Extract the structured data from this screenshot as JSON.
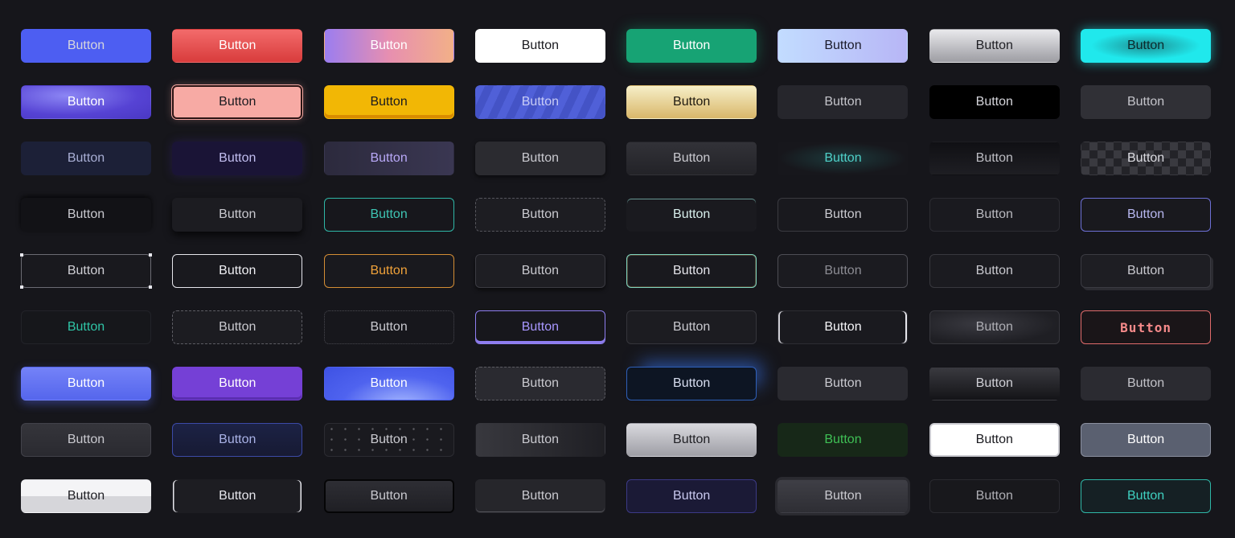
{
  "label": "Button",
  "colors": {
    "page_bg": "#16161b",
    "indigo": "#4b5cf0",
    "red": "#e54a4a",
    "green": "#19a577",
    "cyan": "#1fe6ea",
    "yellow": "#f2b705",
    "salmon": "#f7a9a3",
    "teal": "#2fb7a7",
    "orange": "#f0a23a",
    "violet": "#7540d6",
    "blue_glow": "#3a7bff",
    "pink_outline": "#f26b6b",
    "lime": "#2bbd43"
  },
  "rows": [
    [
      {
        "name": "solid-indigo-button"
      },
      {
        "name": "red-gradient-button"
      },
      {
        "name": "sunset-gradient-button"
      },
      {
        "name": "white-solid-button"
      },
      {
        "name": "green-solid-button"
      },
      {
        "name": "pastel-blue-gradient-button"
      },
      {
        "name": "silver-gradient-button"
      },
      {
        "name": "neon-cyan-button"
      }
    ],
    [
      {
        "name": "indigo-shine-button"
      },
      {
        "name": "salmon-outlined-button"
      },
      {
        "name": "yellow-3d-button"
      },
      {
        "name": "striped-blue-button"
      },
      {
        "name": "gold-gradient-button"
      },
      {
        "name": "dark-flat-button"
      },
      {
        "name": "black-solid-button"
      },
      {
        "name": "charcoal-flat-button"
      }
    ],
    [
      {
        "name": "navy-ghost-button"
      },
      {
        "name": "deep-purple-button"
      },
      {
        "name": "lavender-text-button"
      },
      {
        "name": "dark-raised-button"
      },
      {
        "name": "dark-gradient-button"
      },
      {
        "name": "teal-glow-text-button"
      },
      {
        "name": "black-fade-button"
      },
      {
        "name": "checkered-button"
      }
    ],
    [
      {
        "name": "black-shadow-button"
      },
      {
        "name": "dark-drop-shadow-button"
      },
      {
        "name": "teal-outline-button"
      },
      {
        "name": "dashed-outline-button"
      },
      {
        "name": "light-beam-button"
      },
      {
        "name": "thin-outline-button"
      },
      {
        "name": "subtle-outline-button"
      },
      {
        "name": "violet-outline-button"
      }
    ],
    [
      {
        "name": "selection-handles-button"
      },
      {
        "name": "white-outline-button"
      },
      {
        "name": "orange-outline-button"
      },
      {
        "name": "dark-border-button"
      },
      {
        "name": "gradient-border-button"
      },
      {
        "name": "sparkle-outline-button"
      },
      {
        "name": "crosshair-lines-button"
      },
      {
        "name": "stacked-outline-button"
      }
    ],
    [
      {
        "name": "teal-text-ghost-button"
      },
      {
        "name": "dashed-grey-button"
      },
      {
        "name": "dotted-border-button"
      },
      {
        "name": "purple-underline-button"
      },
      {
        "name": "dark-outline-button"
      },
      {
        "name": "white-edge-button"
      },
      {
        "name": "spotlight-button"
      },
      {
        "name": "pixel-pink-button"
      }
    ],
    [
      {
        "name": "periwinkle-solid-button"
      },
      {
        "name": "violet-solid-button"
      },
      {
        "name": "blue-glow-gradient-button"
      },
      {
        "name": "dashed-fill-button"
      },
      {
        "name": "blue-aura-button"
      },
      {
        "name": "grey-flat-button"
      },
      {
        "name": "black-gloss-button"
      },
      {
        "name": "slate-flat-button"
      }
    ],
    [
      {
        "name": "graphite-button"
      },
      {
        "name": "navy-outline-button"
      },
      {
        "name": "particle-button"
      },
      {
        "name": "smoke-gradient-button"
      },
      {
        "name": "silver-solid-button"
      },
      {
        "name": "green-text-button"
      },
      {
        "name": "white-framed-button"
      },
      {
        "name": "steel-grey-button"
      }
    ],
    [
      {
        "name": "light-grey-button"
      },
      {
        "name": "white-side-border-button"
      },
      {
        "name": "black-frame-button"
      },
      {
        "name": "dark-underline-button"
      },
      {
        "name": "indigo-dark-button"
      },
      {
        "name": "raised-grey-button"
      },
      {
        "name": "faded-outline-button"
      },
      {
        "name": "teal-border-button"
      }
    ]
  ]
}
